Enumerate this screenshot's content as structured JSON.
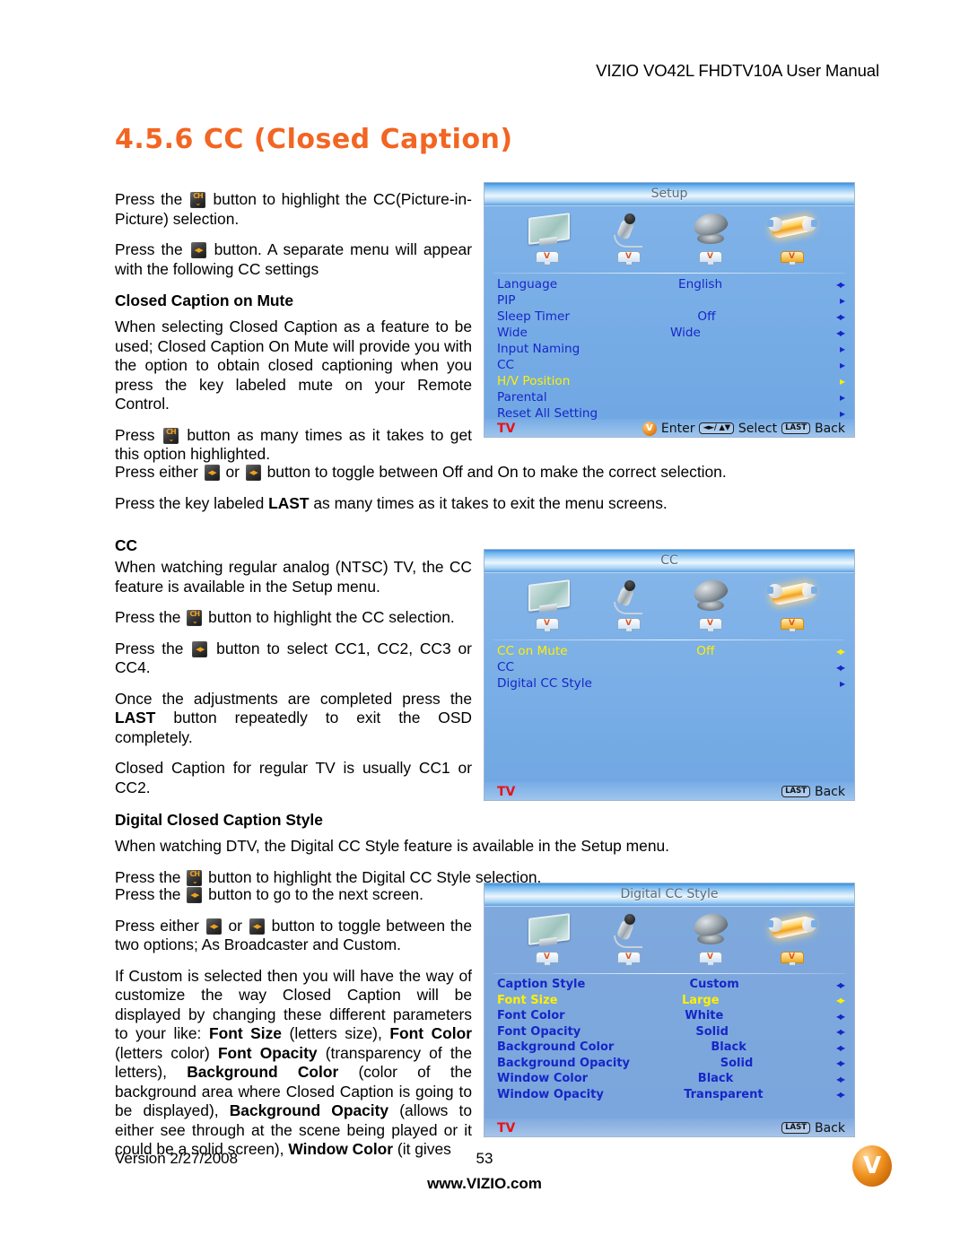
{
  "header": {
    "manual_title": "VIZIO VO42L FHDTV10A User Manual"
  },
  "section": {
    "title": "4.5.6 CC (Closed Caption)"
  },
  "body": {
    "p1_a": "Press the",
    "p1_b": "button to highlight the CC(Picture-in-Picture) selection.",
    "p2_a": "Press the",
    "p2_b": "button. A separate menu will appear with the following CC settings",
    "h_closed_caption_on_mute": "Closed Caption on Mute",
    "p3": "When selecting Closed Caption as a feature to be used; Closed Caption On Mute will provide you with the option to obtain closed captioning when you press the key labeled mute on your Remote Control.",
    "p4_a": "Press",
    "p4_b": "button as many times as it takes to get this option highlighted.",
    "p5_a": "Press either",
    "p5_mid": "or",
    "p5_b": "button to toggle between Off and On to make the correct selection.",
    "p6_a": "Press the key labeled",
    "p6_bold": "LAST",
    "p6_b": "as many times as it takes to exit the menu screens.",
    "h_cc": "CC",
    "p7": "When watching regular analog (NTSC) TV, the CC feature is available in the Setup menu.",
    "p8_a": "Press the",
    "p8_b": "button to highlight the  CC selection.",
    "p9_a": "Press the",
    "p9_b": "button to select CC1, CC2, CC3 or CC4.",
    "p10_a": "Once the adjustments are completed press the",
    "p10_bold": "LAST",
    "p10_b": "button repeatedly to exit the OSD completely.",
    "p11": "Closed Caption for regular TV is usually CC1 or CC2.",
    "h_digital_cc_style": "Digital Closed Caption Style",
    "p12": "When watching DTV, the Digital CC Style feature is available in the Setup menu.",
    "p13_a": "Press the",
    "p13_b": "button to highlight the Digital CC Style selection.",
    "p14_a": "Press the",
    "p14_b": "button to go to the next screen.",
    "p15_a": "Press either",
    "p15_mid": "or",
    "p15_b": "button to toggle between the two options; As Broadcaster and Custom.",
    "p16_seg1": "If Custom is selected then you will have the way of customize the way Closed Caption will be displayed by changing these different parameters to your like: ",
    "p16_b1": "Font Size",
    "p16_seg2": " (letters size), ",
    "p16_b2": "Font Color",
    "p16_seg3": " (letters color) ",
    "p16_b3": "Font Opacity",
    "p16_seg4": " (transparency of the letters), ",
    "p16_b4": "Background Color",
    "p16_seg5": " (color of the background area where Closed Caption is going to be displayed), ",
    "p16_b5": "Background Opacity",
    "p16_seg6": " (allows to either see through at the scene being played or it could be a solid screen), ",
    "p16_b6": "Window Color",
    "p16_seg7": " (it gives"
  },
  "keys": {
    "ch_updown": "CH",
    "left_right": "VOL"
  },
  "osd_setup": {
    "title": "Setup",
    "tabs": [
      {
        "icon": "tv-icon",
        "active": false
      },
      {
        "icon": "microphone-icon",
        "active": false
      },
      {
        "icon": "satellite-dish-icon",
        "active": false
      },
      {
        "icon": "wrench-setup-icon",
        "active": true
      }
    ],
    "rows": [
      {
        "label": "Language",
        "value": "English",
        "arrow": "leftright",
        "highlight": false
      },
      {
        "label": "PIP",
        "value": "",
        "arrow": "right",
        "highlight": false
      },
      {
        "label": "Sleep Timer",
        "value": "Off",
        "arrow": "leftright",
        "highlight": false
      },
      {
        "label": "Wide",
        "value": "Wide",
        "arrow": "leftright",
        "highlight": false
      },
      {
        "label": "Input Naming",
        "value": "",
        "arrow": "right",
        "highlight": false
      },
      {
        "label": "CC",
        "value": "",
        "arrow": "right",
        "highlight": false
      },
      {
        "label": "H/V Position",
        "value": "",
        "arrow": "right",
        "highlight": true
      },
      {
        "label": "Parental",
        "value": "",
        "arrow": "right",
        "highlight": false
      },
      {
        "label": "Reset All Setting",
        "value": "",
        "arrow": "right",
        "highlight": false
      }
    ],
    "footer": {
      "source": "TV",
      "enter": "Enter",
      "select": "Select",
      "select_key": "◄►/ ▲▼",
      "back": "Back",
      "back_key": "LAST"
    }
  },
  "osd_cc": {
    "title": "CC",
    "tabs": [
      {
        "icon": "tv-icon",
        "active": false
      },
      {
        "icon": "microphone-icon",
        "active": false
      },
      {
        "icon": "satellite-dish-icon",
        "active": false
      },
      {
        "icon": "wrench-setup-icon",
        "active": true
      }
    ],
    "rows": [
      {
        "label": "CC on Mute",
        "value": "Off",
        "arrow": "leftright",
        "highlight": true
      },
      {
        "label": "CC",
        "value": "",
        "arrow": "leftright",
        "highlight": false
      },
      {
        "label": "Digital CC Style",
        "value": "",
        "arrow": "right",
        "highlight": false
      }
    ],
    "footer": {
      "source": "TV",
      "back": "Back",
      "back_key": "LAST"
    }
  },
  "osd_digital_cc_style": {
    "title": "Digital CC Style",
    "tabs": [
      {
        "icon": "tv-icon",
        "active": false
      },
      {
        "icon": "microphone-icon",
        "active": false
      },
      {
        "icon": "satellite-dish-icon",
        "active": false
      },
      {
        "icon": "wrench-setup-icon",
        "active": true
      }
    ],
    "rows": [
      {
        "label": "Caption Style",
        "value": "Custom",
        "arrow": "leftright",
        "highlight": false
      },
      {
        "label": "Font Size",
        "value": "Large",
        "arrow": "leftright",
        "highlight": true
      },
      {
        "label": "Font Color",
        "value": "White",
        "arrow": "leftright",
        "highlight": false
      },
      {
        "label": "Font Opacity",
        "value": "Solid",
        "arrow": "leftright",
        "highlight": false
      },
      {
        "label": "Background Color",
        "value": "Black",
        "arrow": "leftright",
        "highlight": false
      },
      {
        "label": "Background Opacity",
        "value": "Solid",
        "arrow": "leftright",
        "highlight": false
      },
      {
        "label": "Window Color",
        "value": "Black",
        "arrow": "leftright",
        "highlight": false
      },
      {
        "label": "Window Opacity",
        "value": "Transparent",
        "arrow": "leftright",
        "highlight": false
      }
    ],
    "footer": {
      "source": "TV",
      "back": "Back",
      "back_key": "LAST"
    }
  },
  "footer": {
    "version": "Version 2/27/2008",
    "page_number": "53",
    "url": "www.VIZIO.com",
    "logo_letter": "V"
  },
  "colors": {
    "accent_orange": "#F26522",
    "menu_blue": "#1726C8",
    "highlight_yellow": "#FFF000",
    "tv_red": "#E8121A",
    "osd_bg": "#7AAEE6"
  }
}
